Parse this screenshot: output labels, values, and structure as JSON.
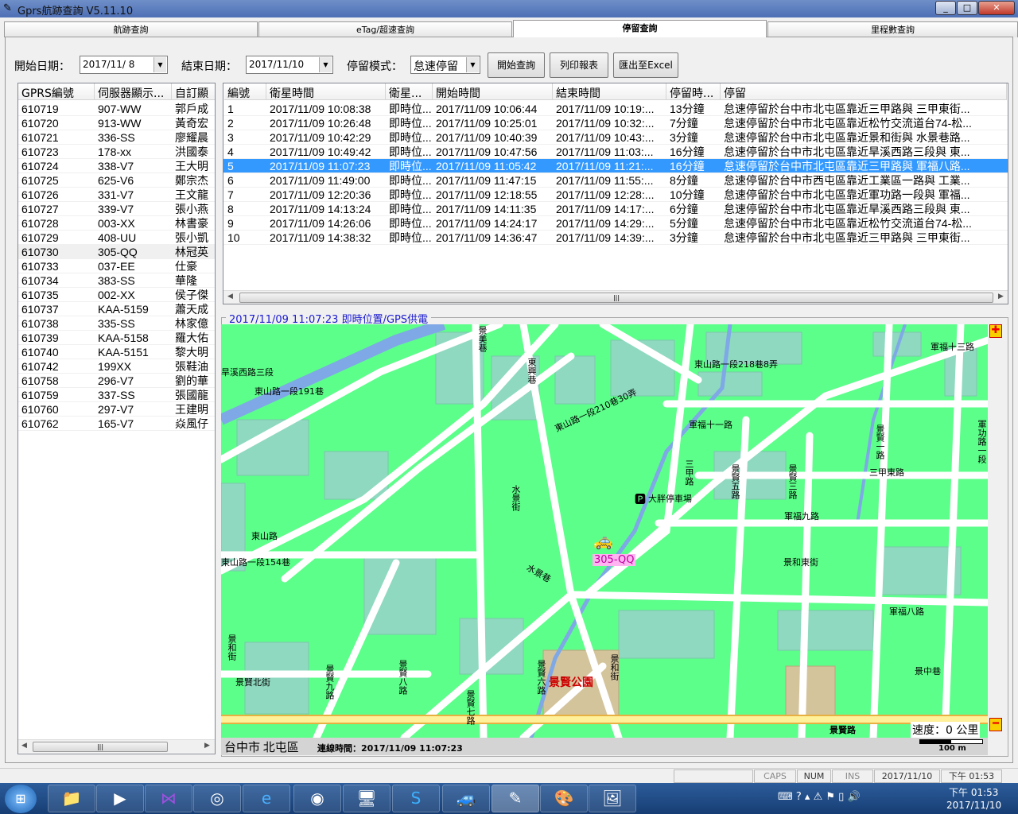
{
  "window": {
    "title": "Gprs航跡查詢 V5.11.10",
    "min": "_",
    "max": "□",
    "close": "✕"
  },
  "tabs": [
    {
      "label": "航跡查詢"
    },
    {
      "label": "eTag/超速查詢"
    },
    {
      "label": "停留查詢",
      "active": true
    },
    {
      "label": "里程數查詢"
    }
  ],
  "toolbar": {
    "start_label": "開始日期：",
    "start_value": "2017/11/ 8",
    "end_label": "結束日期：",
    "end_value": "2017/11/10",
    "mode_label": "停留模式：",
    "mode_value": "怠速停留",
    "query": "開始查詢",
    "print": "列印報表",
    "export": "匯出至Excel"
  },
  "vehicles": {
    "columns": [
      "GPRS編號",
      "伺服器顯示...",
      "自訂顯"
    ],
    "rows": [
      [
        "610719",
        "907-WW",
        "郭戶成"
      ],
      [
        "610720",
        "913-WW",
        "黃奇宏"
      ],
      [
        "610721",
        "336-SS",
        "廖耀晨"
      ],
      [
        "610723",
        "178-xx",
        "洪國泰"
      ],
      [
        "610724",
        "338-V7",
        "王大明"
      ],
      [
        "610725",
        "625-V6",
        "鄭宗杰"
      ],
      [
        "610726",
        "331-V7",
        "王文龍"
      ],
      [
        "610727",
        "339-V7",
        "張小燕"
      ],
      [
        "610728",
        "003-XX",
        "林書豪"
      ],
      [
        "610729",
        "408-UU",
        "張小凱"
      ],
      [
        "610730",
        "305-QQ",
        "林冠英"
      ],
      [
        "610733",
        "037-EE",
        "仕豪"
      ],
      [
        "610734",
        "383-SS",
        "華隆"
      ],
      [
        "610735",
        "002-XX",
        "侯子傑"
      ],
      [
        "610737",
        "KAA-5159",
        "蕭天成"
      ],
      [
        "610738",
        "335-SS",
        "林家億"
      ],
      [
        "610739",
        "KAA-5158",
        "羅大佑"
      ],
      [
        "610740",
        "KAA-5151",
        "黎大明"
      ],
      [
        "610742",
        "199XX",
        "張鞋油"
      ],
      [
        "610758",
        "296-V7",
        "劉的華"
      ],
      [
        "610759",
        "337-SS",
        "張國龍"
      ],
      [
        "610760",
        "297-V7",
        "王建明"
      ],
      [
        "610762",
        "165-V7",
        "焱風仔"
      ]
    ],
    "highlighted_index": 10
  },
  "stops": {
    "columns": [
      "編號",
      "衛星時間",
      "衛星...",
      "開始時間",
      "結束時間",
      "停留時...",
      "停留"
    ],
    "rows": [
      [
        "1",
        "2017/11/09 10:08:38",
        "即時位...",
        "2017/11/09 10:06:44",
        "2017/11/09 10:19:...",
        "13分鐘",
        "怠速停留於台中市北屯區靠近三甲路與 三甲東街..."
      ],
      [
        "2",
        "2017/11/09 10:26:48",
        "即時位...",
        "2017/11/09 10:25:01",
        "2017/11/09 10:32:...",
        "7分鐘",
        "怠速停留於台中市北屯區靠近松竹交流道台74-松..."
      ],
      [
        "3",
        "2017/11/09 10:42:29",
        "即時位...",
        "2017/11/09 10:40:39",
        "2017/11/09 10:43:...",
        "3分鐘",
        "怠速停留於台中市北屯區靠近景和街與 水景巷路..."
      ],
      [
        "4",
        "2017/11/09 10:49:42",
        "即時位...",
        "2017/11/09 10:47:56",
        "2017/11/09 11:03:...",
        "16分鐘",
        "怠速停留於台中市北屯區靠近旱溪西路三段與 東..."
      ],
      [
        "5",
        "2017/11/09 11:07:23",
        "即時位...",
        "2017/11/09 11:05:42",
        "2017/11/09 11:21:...",
        "16分鐘",
        "怠速停留於台中市北屯區靠近三甲路與 軍福八路..."
      ],
      [
        "6",
        "2017/11/09 11:49:00",
        "即時位...",
        "2017/11/09 11:47:15",
        "2017/11/09 11:55:...",
        "8分鐘",
        "怠速停留於台中市西屯區靠近工業區一路與 工業..."
      ],
      [
        "7",
        "2017/11/09 12:20:36",
        "即時位...",
        "2017/11/09 12:18:55",
        "2017/11/09 12:28:...",
        "10分鐘",
        "怠速停留於台中市北屯區靠近軍功路一段與 軍福..."
      ],
      [
        "8",
        "2017/11/09 14:13:24",
        "即時位...",
        "2017/11/09 14:11:35",
        "2017/11/09 14:17:...",
        "6分鐘",
        "怠速停留於台中市北屯區靠近旱溪西路三段與 東..."
      ],
      [
        "9",
        "2017/11/09 14:26:06",
        "即時位...",
        "2017/11/09 14:24:17",
        "2017/11/09 14:29:...",
        "5分鐘",
        "怠速停留於台中市北屯區靠近松竹交流道台74-松..."
      ],
      [
        "10",
        "2017/11/09 14:38:32",
        "即時位...",
        "2017/11/09 14:36:47",
        "2017/11/09 14:39:...",
        "3分鐘",
        "怠速停留於台中市北屯區靠近三甲路與 三甲東街..."
      ]
    ],
    "selected_index": 4
  },
  "map": {
    "group_title": "2017/11/09 11:07:23 即時位置/GPS供電",
    "vehicle_label": "305-QQ",
    "parking": "大胖停車場",
    "park": "景賢公園",
    "streets_h": [
      "旱溪西路三段",
      "東山路一段191巷",
      "東山路一段218巷8弄",
      "軍福十三路",
      "軍福十一路",
      "三甲東路",
      "軍福九路",
      "東山路一段154巷",
      "東山路",
      "景和東街",
      "軍福八路",
      "景賢北街",
      "景中巷",
      "景賢路",
      "東山路一段210巷30弄"
    ],
    "streets_v": [
      "景美巷",
      "東興巷",
      "三甲路",
      "景賢五路",
      "景賢三路",
      "景賢一路",
      "軍功路一段",
      "水景街",
      "水景巷",
      "景和街",
      "景賢九路",
      "景賢八路",
      "景賢六路",
      "景和街",
      "景賢七路"
    ],
    "district": "台中市 北屯區",
    "connect_time": "連線時間：2017/11/09 11:07:23",
    "speed": "速度：0 公里",
    "scale": "100 m",
    "colors": {
      "land": "#5cff8a",
      "block": "#8fd9c0",
      "road": "#ffffff",
      "river": "#7fa8e6",
      "highway": "#fff09a"
    }
  },
  "statusbar": {
    "caps": "CAPS",
    "num": "NUM",
    "ins": "INS",
    "date": "2017/11/10",
    "time": "下午 01:53"
  },
  "taskbar": {
    "clock_time": "下午 01:53",
    "clock_date": "2017/11/10"
  }
}
